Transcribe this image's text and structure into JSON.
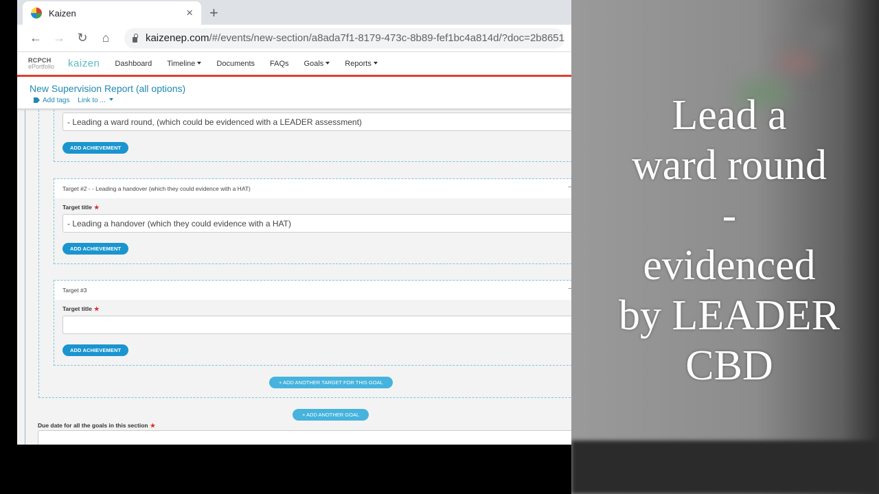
{
  "browser": {
    "tab_title": "Kaizen",
    "tab_close": "×",
    "new_tab": "+",
    "back": "←",
    "forward": "→",
    "reload": "↻",
    "home": "⌂",
    "url_host": "kaizenep.com",
    "url_path": "/#/events/new-section/a8ada7f1-8179-473c-8b89-fef1bc4a814d/?doc=2b8651"
  },
  "app": {
    "logo_rcpch_line1": "RCPCH",
    "logo_rcpch_line2": "ePortfolio",
    "logo_kaizen": "kaizen",
    "nav": {
      "dashboard": "Dashboard",
      "timeline": "Timeline",
      "documents": "Documents",
      "faqs": "FAQs",
      "goals": "Goals",
      "reports": "Reports"
    },
    "page_title": "New Supervision Report (all options)",
    "add_tags": "Add tags",
    "link_to": "Link to ..."
  },
  "targets": {
    "t1_value": "-      Leading a ward round, (which could be evidenced with a LEADER assessment)",
    "t2_header": "Target #2 - - Leading a handover (which they could evidence with a HAT)",
    "t2_value": "-      Leading a handover (which they could evidence with a HAT)",
    "t3_header": "Target #3",
    "target_title_label": "Target title",
    "required": "★",
    "collapse": "–",
    "add_achievement": "ADD ACHIEVEMENT"
  },
  "actions": {
    "add_target": "+ ADD ANOTHER TARGET FOR THIS GOAL",
    "add_goal": "+ ADD ANOTHER GOAL"
  },
  "due_date_label": "Due date for all the goals in this section",
  "overlay": {
    "line1": "Lead a",
    "line2": "ward round",
    "line3": "-",
    "line4": "evidenced",
    "line5": "by LEADER",
    "line6": "CBD"
  }
}
